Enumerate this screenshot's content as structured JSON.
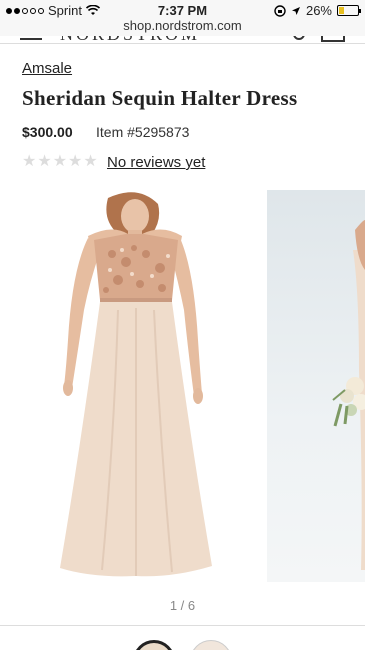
{
  "status_bar": {
    "carrier": "Sprint",
    "time": "7:37 PM",
    "battery": "26%",
    "battery_level": 0.26
  },
  "url_bar": {
    "url": "shop.nordstrom.com"
  },
  "header": {
    "logo_text": "NORDSTROM"
  },
  "product": {
    "brand": "Amsale",
    "title": "Sheridan Sequin Halter Dress",
    "price": "$300.00",
    "item_number": "Item #5295873",
    "rating_stars": 0,
    "reviews_link": "No reviews yet"
  },
  "gallery": {
    "pager": "1 / 6",
    "images": [
      {
        "icon": "dress-photo-front"
      },
      {
        "icon": "dress-photo-bouquet"
      }
    ]
  },
  "colors": {
    "dress_blush": "#efdccb",
    "sequin_rose": "#d9a98c",
    "battery_yellow": "#e8c020"
  }
}
